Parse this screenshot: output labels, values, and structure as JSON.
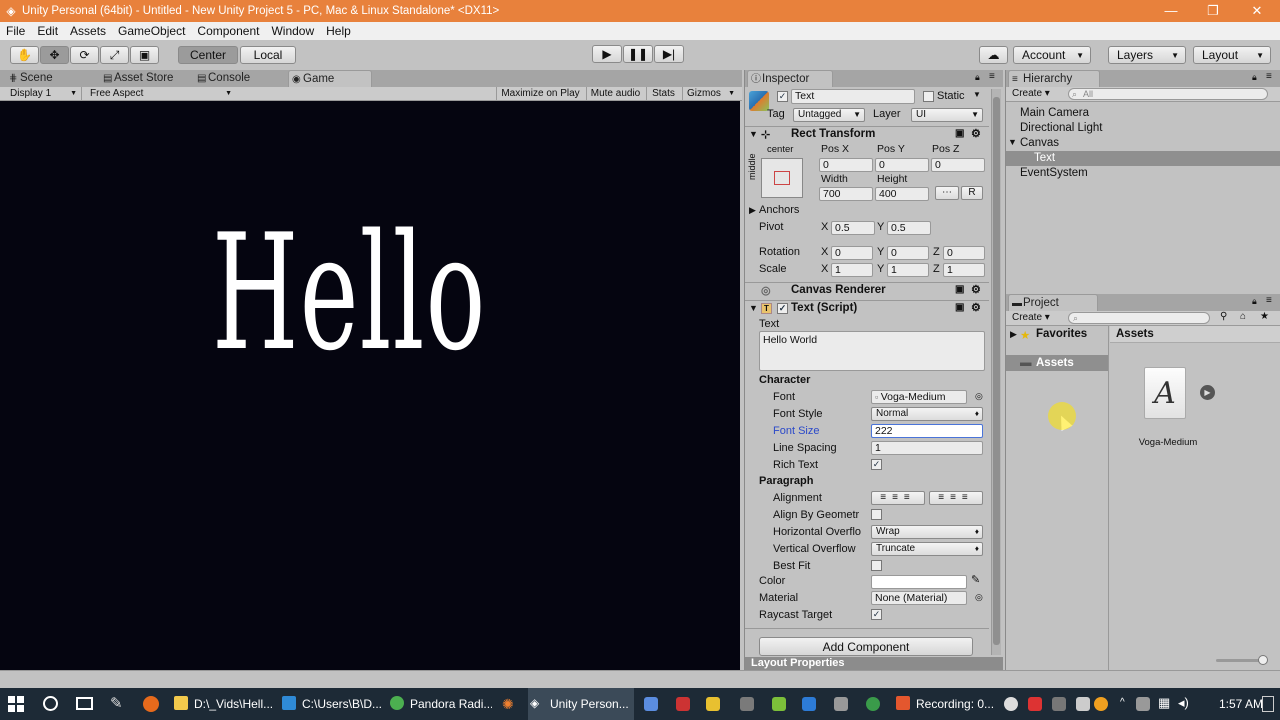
{
  "window": {
    "title": "Unity Personal (64bit) - Untitled - New Unity Project 5 - PC, Mac & Linux Standalone* <DX11>"
  },
  "menu": [
    "File",
    "Edit",
    "Assets",
    "GameObject",
    "Component",
    "Window",
    "Help"
  ],
  "toolbar": {
    "pivot_center": "Center",
    "pivot_local": "Local",
    "account": "Account",
    "layers": "Layers",
    "layout": "Layout"
  },
  "tabs": {
    "scene": "Scene",
    "asset_store": "Asset Store",
    "console": "Console",
    "game": "Game"
  },
  "game_bar": {
    "display": "Display 1",
    "aspect": "Free Aspect",
    "maximize": "Maximize on Play",
    "mute": "Mute audio",
    "stats": "Stats",
    "gizmos": "Gizmos"
  },
  "game_view": {
    "text": "Hello"
  },
  "inspector": {
    "tab": "Inspector",
    "object_name": "Text",
    "static_label": "Static",
    "tag_label": "Tag",
    "tag_value": "Untagged",
    "layer_label": "Layer",
    "layer_value": "UI",
    "rect_transform": {
      "title": "Rect Transform",
      "anchor_h": "center",
      "anchor_v": "middle",
      "posx_label": "Pos X",
      "posy_label": "Pos Y",
      "posz_label": "Pos Z",
      "posx": "0",
      "posy": "0",
      "posz": "0",
      "width_label": "Width",
      "height_label": "Height",
      "width": "700",
      "height": "400",
      "r_button": "R",
      "anchors": "Anchors",
      "pivot_label": "Pivot",
      "pivot_x": "0.5",
      "pivot_y": "0.5",
      "rotation_label": "Rotation",
      "rot_x": "0",
      "rot_y": "0",
      "rot_z": "0",
      "scale_label": "Scale",
      "scale_x": "1",
      "scale_y": "1",
      "scale_z": "1",
      "x": "X",
      "y": "Y",
      "z": "Z"
    },
    "canvas_renderer": "Canvas Renderer",
    "text_script": {
      "title": "Text (Script)",
      "text_label": "Text",
      "text_value": "Hello World",
      "character": "Character",
      "font_label": "Font",
      "font_value": "Voga-Medium",
      "font_style_label": "Font Style",
      "font_style_value": "Normal",
      "font_size_label": "Font Size",
      "font_size_value": "222",
      "line_spacing_label": "Line Spacing",
      "line_spacing_value": "1",
      "rich_text_label": "Rich Text",
      "paragraph": "Paragraph",
      "alignment_label": "Alignment",
      "align_geometry_label": "Align By Geometr",
      "h_overflow_label": "Horizontal Overflo",
      "h_overflow_value": "Wrap",
      "v_overflow_label": "Vertical Overflow",
      "v_overflow_value": "Truncate",
      "best_fit_label": "Best Fit",
      "color_label": "Color",
      "material_label": "Material",
      "material_value": "None (Material)",
      "raycast_label": "Raycast Target"
    },
    "add_component": "Add Component",
    "layout_properties": "Layout Properties"
  },
  "hierarchy": {
    "tab": "Hierarchy",
    "create": "Create",
    "search_placeholder": "All",
    "items": [
      "Main Camera",
      "Directional Light",
      "Canvas",
      "Text",
      "EventSystem"
    ]
  },
  "project": {
    "tab": "Project",
    "create": "Create",
    "favorites": "Favorites",
    "assets_folder": "Assets",
    "assets_header": "Assets",
    "asset_name": "Voga-Medium",
    "asset_glyph": "A"
  },
  "taskbar": {
    "tasks": [
      "D:\\_Vids\\Hell...",
      "C:\\Users\\B\\D...",
      "Pandora Radi...",
      "Unity Person...",
      "Recording: 0..."
    ],
    "clock": "1:57 AM"
  },
  "colors": {
    "titlebar": "#e8813c",
    "game_bg": "#050510",
    "selection": "#8f8f8f",
    "font_size_label": "#2b49c9"
  }
}
